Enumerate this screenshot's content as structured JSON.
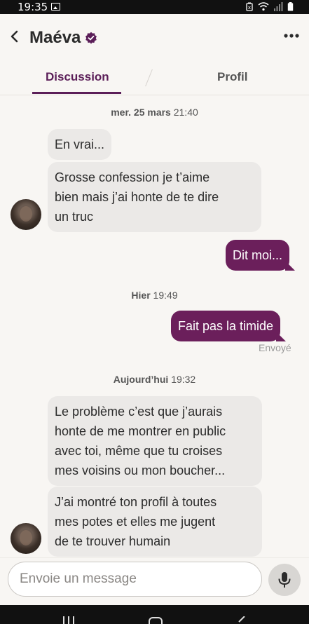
{
  "status_bar": {
    "time": "19:35"
  },
  "header": {
    "contact_name": "Maéva"
  },
  "tabs": [
    {
      "label": "Discussion",
      "active": true
    },
    {
      "label": "Profil",
      "active": false
    }
  ],
  "conversation": {
    "date1": {
      "day": "mer. 25 mars",
      "time": "21:40"
    },
    "msg1": "En vrai...",
    "msg2_line1": "Grosse confession je t’aime",
    "msg2_line2": "bien mais j’ai honte de te dire",
    "msg2_line3": "un truc",
    "msg3": "Dit moi...",
    "date2": {
      "day": "Hier",
      "time": "19:49"
    },
    "msg4": "Fait pas la timide",
    "msg4_status": "Envoyé",
    "date3": {
      "day": "Aujourd’hui",
      "time": "19:32"
    },
    "msg5_line1": "Le problème c’est que j’aurais",
    "msg5_line2": "honte de me montrer en public",
    "msg5_line3": "avec toi, même que tu croises",
    "msg5_line4": "mes voisins ou mon boucher...",
    "msg6_line1": "J’ai montré ton profil à toutes",
    "msg6_line2": "mes potes et elles me jugent",
    "msg6_line3": "de te trouver humain"
  },
  "composer": {
    "placeholder": "Envoie un message"
  },
  "colors": {
    "accent": "#5b1e58",
    "outgoing_bubble": "#6b1f5b",
    "incoming_bubble": "#ebe9e7"
  },
  "icons": [
    "image-icon",
    "battery-icon",
    "wifi-icon",
    "signal-icon",
    "back-arrow-icon",
    "verified-badge-icon",
    "more-options-icon",
    "microphone-icon",
    "recent-apps-icon",
    "home-icon",
    "back-nav-icon"
  ]
}
